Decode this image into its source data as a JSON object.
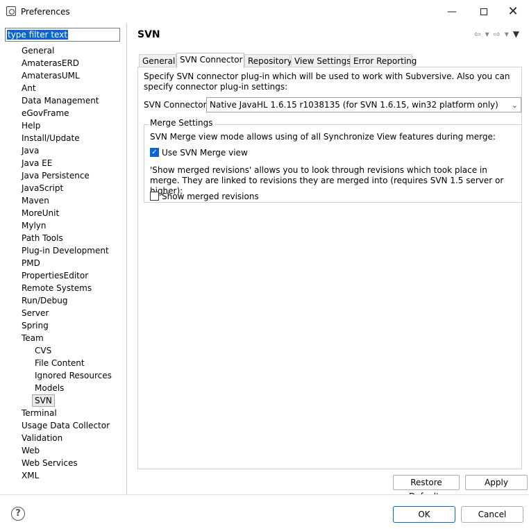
{
  "window": {
    "title": "Preferences",
    "min_glyph": "—",
    "close_glyph": "✕"
  },
  "sidebar": {
    "filter_text": "type filter text",
    "items": [
      {
        "label": "General",
        "level": 0
      },
      {
        "label": "AmaterasERD",
        "level": 0
      },
      {
        "label": "AmaterasUML",
        "level": 0
      },
      {
        "label": "Ant",
        "level": 0
      },
      {
        "label": "Data Management",
        "level": 0
      },
      {
        "label": "eGovFrame",
        "level": 0
      },
      {
        "label": "Help",
        "level": 0
      },
      {
        "label": "Install/Update",
        "level": 0
      },
      {
        "label": "Java",
        "level": 0
      },
      {
        "label": "Java EE",
        "level": 0
      },
      {
        "label": "Java Persistence",
        "level": 0
      },
      {
        "label": "JavaScript",
        "level": 0
      },
      {
        "label": "Maven",
        "level": 0
      },
      {
        "label": "MoreUnit",
        "level": 0
      },
      {
        "label": "Mylyn",
        "level": 0
      },
      {
        "label": "Path Tools",
        "level": 0
      },
      {
        "label": "Plug-in Development",
        "level": 0
      },
      {
        "label": "PMD",
        "level": 0
      },
      {
        "label": "PropertiesEditor",
        "level": 0
      },
      {
        "label": "Remote Systems",
        "level": 0
      },
      {
        "label": "Run/Debug",
        "level": 0
      },
      {
        "label": "Server",
        "level": 0
      },
      {
        "label": "Spring",
        "level": 0
      },
      {
        "label": "Team",
        "level": 0
      },
      {
        "label": "CVS",
        "level": 1
      },
      {
        "label": "File Content",
        "level": 1
      },
      {
        "label": "Ignored Resources",
        "level": 1
      },
      {
        "label": "Models",
        "level": 1
      },
      {
        "label": "SVN",
        "level": 1,
        "selected": true
      },
      {
        "label": "Terminal",
        "level": 0
      },
      {
        "label": "Usage Data Collector",
        "level": 0
      },
      {
        "label": "Validation",
        "level": 0
      },
      {
        "label": "Web",
        "level": 0
      },
      {
        "label": "Web Services",
        "level": 0
      },
      {
        "label": "XML",
        "level": 0
      }
    ]
  },
  "page": {
    "title": "SVN",
    "nav": {
      "back": "⇦",
      "forward": "⇨",
      "dropdown": "▾",
      "menu": "▼"
    },
    "tabs": [
      "General",
      "SVN Connector",
      "Repository",
      "View Settings",
      "Error Reporting"
    ],
    "active_tab": "SVN Connector",
    "description": "Specify SVN connector plug-in which will be used to work with Subversive. Also you can specify connector plug-in settings:",
    "connector_label": "SVN Connector:",
    "connector_value": "Native JavaHL 1.6.15 r1038135 (for SVN 1.6.15, win32 platform only)",
    "merge_group": {
      "title": "Merge Settings",
      "text1": "SVN Merge view mode allows using of all Synchronize View features during merge:",
      "use_merge_view_label": "Use SVN Merge view",
      "use_merge_view_checked": true,
      "text2": "'Show merged revisions' allows you to look through revisions which took place in merge. They are linked to revisions they are merged into (requires SVN 1.5 server or higher):",
      "show_merged_label": "Show merged revisions",
      "show_merged_checked": false
    },
    "restore_defaults": "Restore Defaults",
    "apply": "Apply"
  },
  "footer": {
    "help": "?",
    "ok": "OK",
    "cancel": "Cancel"
  }
}
